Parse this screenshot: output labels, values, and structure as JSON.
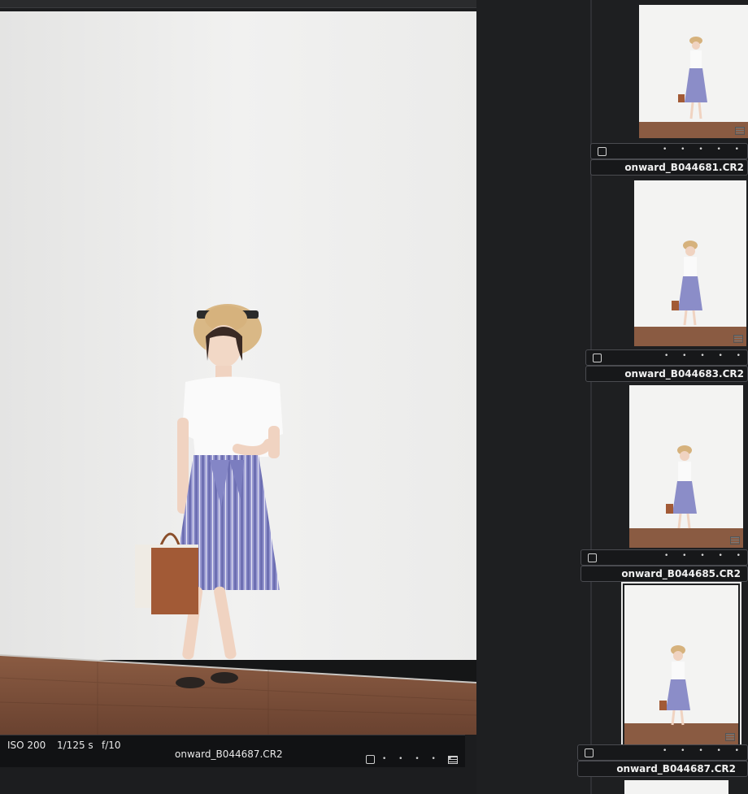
{
  "viewer": {
    "iso": "ISO 200",
    "shutter": "1/125 s",
    "aperture": "f/10",
    "filename": "onward_B044687.CR2",
    "rating_dots": "• • • • •"
  },
  "filmstrip": [
    {
      "filename": "onward_B044681.CR2",
      "rating_dots": "• • • • •",
      "selected": false
    },
    {
      "filename": "onward_B044683.CR2",
      "rating_dots": "• • • • •",
      "selected": false
    },
    {
      "filename": "onward_B044685.CR2",
      "rating_dots": "• • • • •",
      "selected": false
    },
    {
      "filename": "onward_B044687.CR2",
      "rating_dots": "• • • • •",
      "selected": true
    }
  ],
  "colors": {
    "background": "#1c1d1f",
    "wall": "#f3f3f2",
    "floor": "#7a4f38",
    "skirt": "#8b8dc8"
  }
}
